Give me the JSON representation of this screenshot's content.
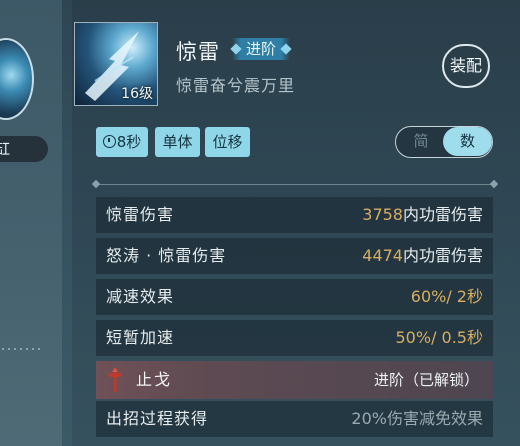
{
  "left": {
    "pill_text": "缸"
  },
  "skill": {
    "name": "惊雷",
    "advance_badge": "进阶",
    "subtitle": "惊雷奋兮震万里",
    "level": "16级",
    "equip_label": "装配"
  },
  "tags": {
    "cooldown": "8秒",
    "target": "单体",
    "movement": "位移"
  },
  "toggle": {
    "simple": "简",
    "detail": "数",
    "selected": "数"
  },
  "stats": [
    {
      "label": "惊雷伤害",
      "number": "3758",
      "unit": "内功雷伤害"
    },
    {
      "label": "怒涛 · 惊雷伤害",
      "number": "4474",
      "unit": "内功雷伤害"
    },
    {
      "label": "减速效果",
      "number": "60%/ 2秒",
      "unit": ""
    },
    {
      "label": "短暂加速",
      "number": "50%/ 0.5秒",
      "unit": ""
    }
  ],
  "upgrade": {
    "name": "止戈",
    "status": "进阶（已解锁）",
    "icon": "halberd-icon"
  },
  "note": {
    "label": "出招过程获得",
    "value": "20%伤害减免效果"
  },
  "colors": {
    "number_gold": "#d7ad62",
    "tag_bg": "#8fd6e8",
    "upgrade_row": "#6f5158"
  }
}
